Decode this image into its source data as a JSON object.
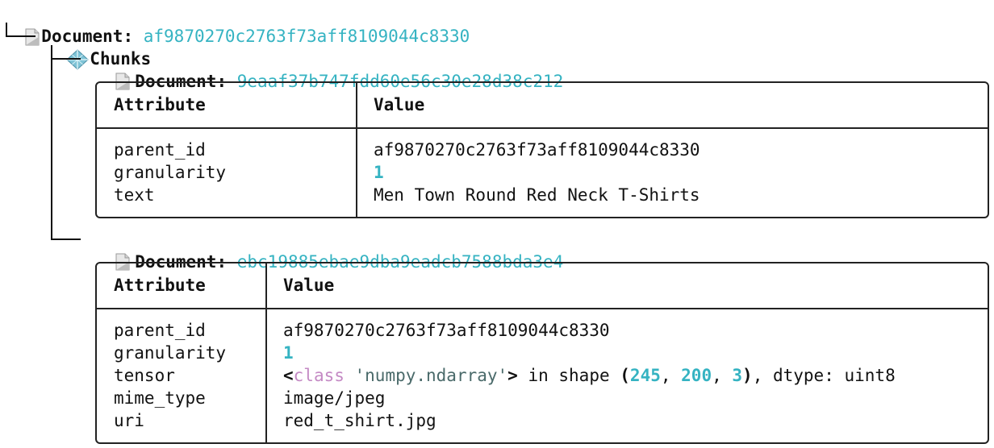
{
  "root": {
    "label": "Document:",
    "id": "af9870270c2763f73aff8109044c8330",
    "icon": "document-icon"
  },
  "chunks": {
    "label": "Chunks",
    "icon": "chunks-diamond-icon"
  },
  "doc1": {
    "label": "Document:",
    "id": "9eaaf37b747fdd60e56c30e28d38c212",
    "icon": "document-icon",
    "table": {
      "header": {
        "attr": "Attribute",
        "value": "Value"
      },
      "rows": [
        {
          "attr": "parent_id",
          "value": "af9870270c2763f73aff8109044c8330"
        },
        {
          "attr": "granularity",
          "value": "1"
        },
        {
          "attr": "text",
          "value": "Men Town Round Red Neck T-Shirts"
        }
      ]
    }
  },
  "doc2": {
    "label": "Document:",
    "id": "ebc19885ebae9dba9eadcb7588bda3e4",
    "icon": "document-icon",
    "table": {
      "header": {
        "attr": "Attribute",
        "value": "Value"
      },
      "rows": [
        {
          "attr": "parent_id",
          "value": "af9870270c2763f73aff8109044c8330"
        },
        {
          "attr": "granularity",
          "value": "1"
        },
        {
          "attr": "tensor",
          "value_parts": {
            "lt": "<",
            "kw": "class",
            "str": " 'numpy.ndarray'",
            "gt": ">",
            "mid": " in shape ",
            "lp": "(",
            "n1": "245",
            "c1": ", ",
            "n2": "200",
            "c2": ", ",
            "n3": "3",
            "rp": ")",
            "tail": ", dtype: uint8"
          }
        },
        {
          "attr": "mime_type",
          "value": "image/jpeg"
        },
        {
          "attr": "uri",
          "value": "red_t_shirt.jpg"
        }
      ]
    }
  }
}
